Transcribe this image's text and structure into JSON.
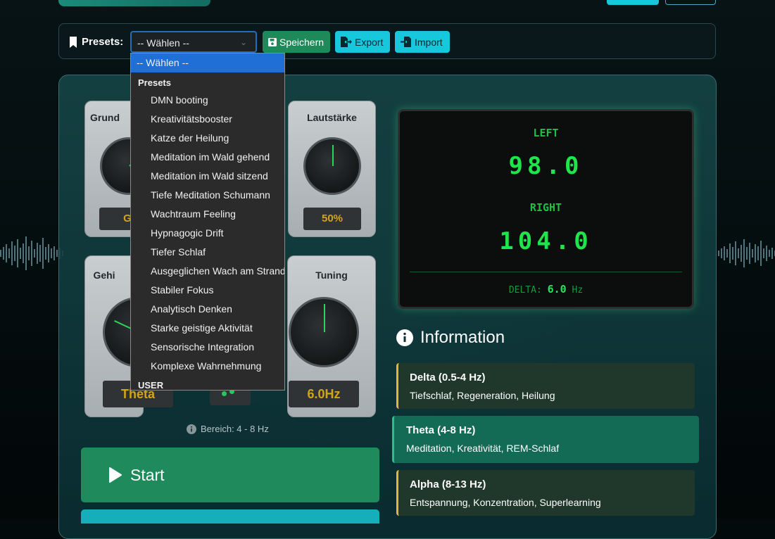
{
  "preset_bar": {
    "label": "Presets:",
    "select_value": "-- Wählen --",
    "save_label": "Speichern",
    "export_label": "Export",
    "import_label": "Import"
  },
  "dropdown": {
    "selected": "-- Wählen --",
    "group_label": "Presets",
    "items": [
      "DMN booting",
      "Kreativitätsbooster",
      "Katze der Heilung",
      "Meditation im Wald gehend",
      "Meditation im Wald sitzend",
      "Tiefe Meditation Schumann",
      "Wachtraum Feeling",
      "Hypnagogic Drift",
      "Tiefer Schlaf",
      "Ausgeglichen Wach am Strand",
      "Stabiler Fokus",
      "Analytisch Denken",
      "Starke geistige Aktivität",
      "Sensorische Integration",
      "Komplexe Wahrnehmung"
    ],
    "user_group_label": "USER"
  },
  "knobs": {
    "grund": {
      "title": "Grund",
      "value": "G"
    },
    "volume": {
      "title": "Lautstärke",
      "value": "50%"
    },
    "gehirn": {
      "title": "Gehi",
      "value": "Theta"
    },
    "tuning": {
      "title": "Tuning",
      "value": "6.0Hz"
    }
  },
  "display": {
    "left_label": "LEFT",
    "left_value": "98.0",
    "right_label": "RIGHT",
    "right_value": "104.0",
    "delta_label": "DELTA:",
    "delta_value": "6.0",
    "delta_unit": "Hz"
  },
  "range_note": "Bereich: 4 - 8 Hz",
  "start_label": "Start",
  "information": {
    "title": "Information",
    "cards": [
      {
        "heading": "Delta (0.5-4 Hz)",
        "desc": "Tiefschlaf, Regeneration, Heilung"
      },
      {
        "heading": "Theta (4-8 Hz)",
        "desc": "Meditation, Kreativität, REM-Schlaf"
      },
      {
        "heading": "Alpha (8-13 Hz)",
        "desc": "Entspannung, Konzentration, Superlearning"
      }
    ]
  },
  "colors": {
    "accent_green": "#1f8b5c",
    "accent_cyan": "#17c8dd",
    "display_green": "#1fe54c",
    "value_gold": "#d4a418",
    "info_border": "#e0b73a"
  }
}
